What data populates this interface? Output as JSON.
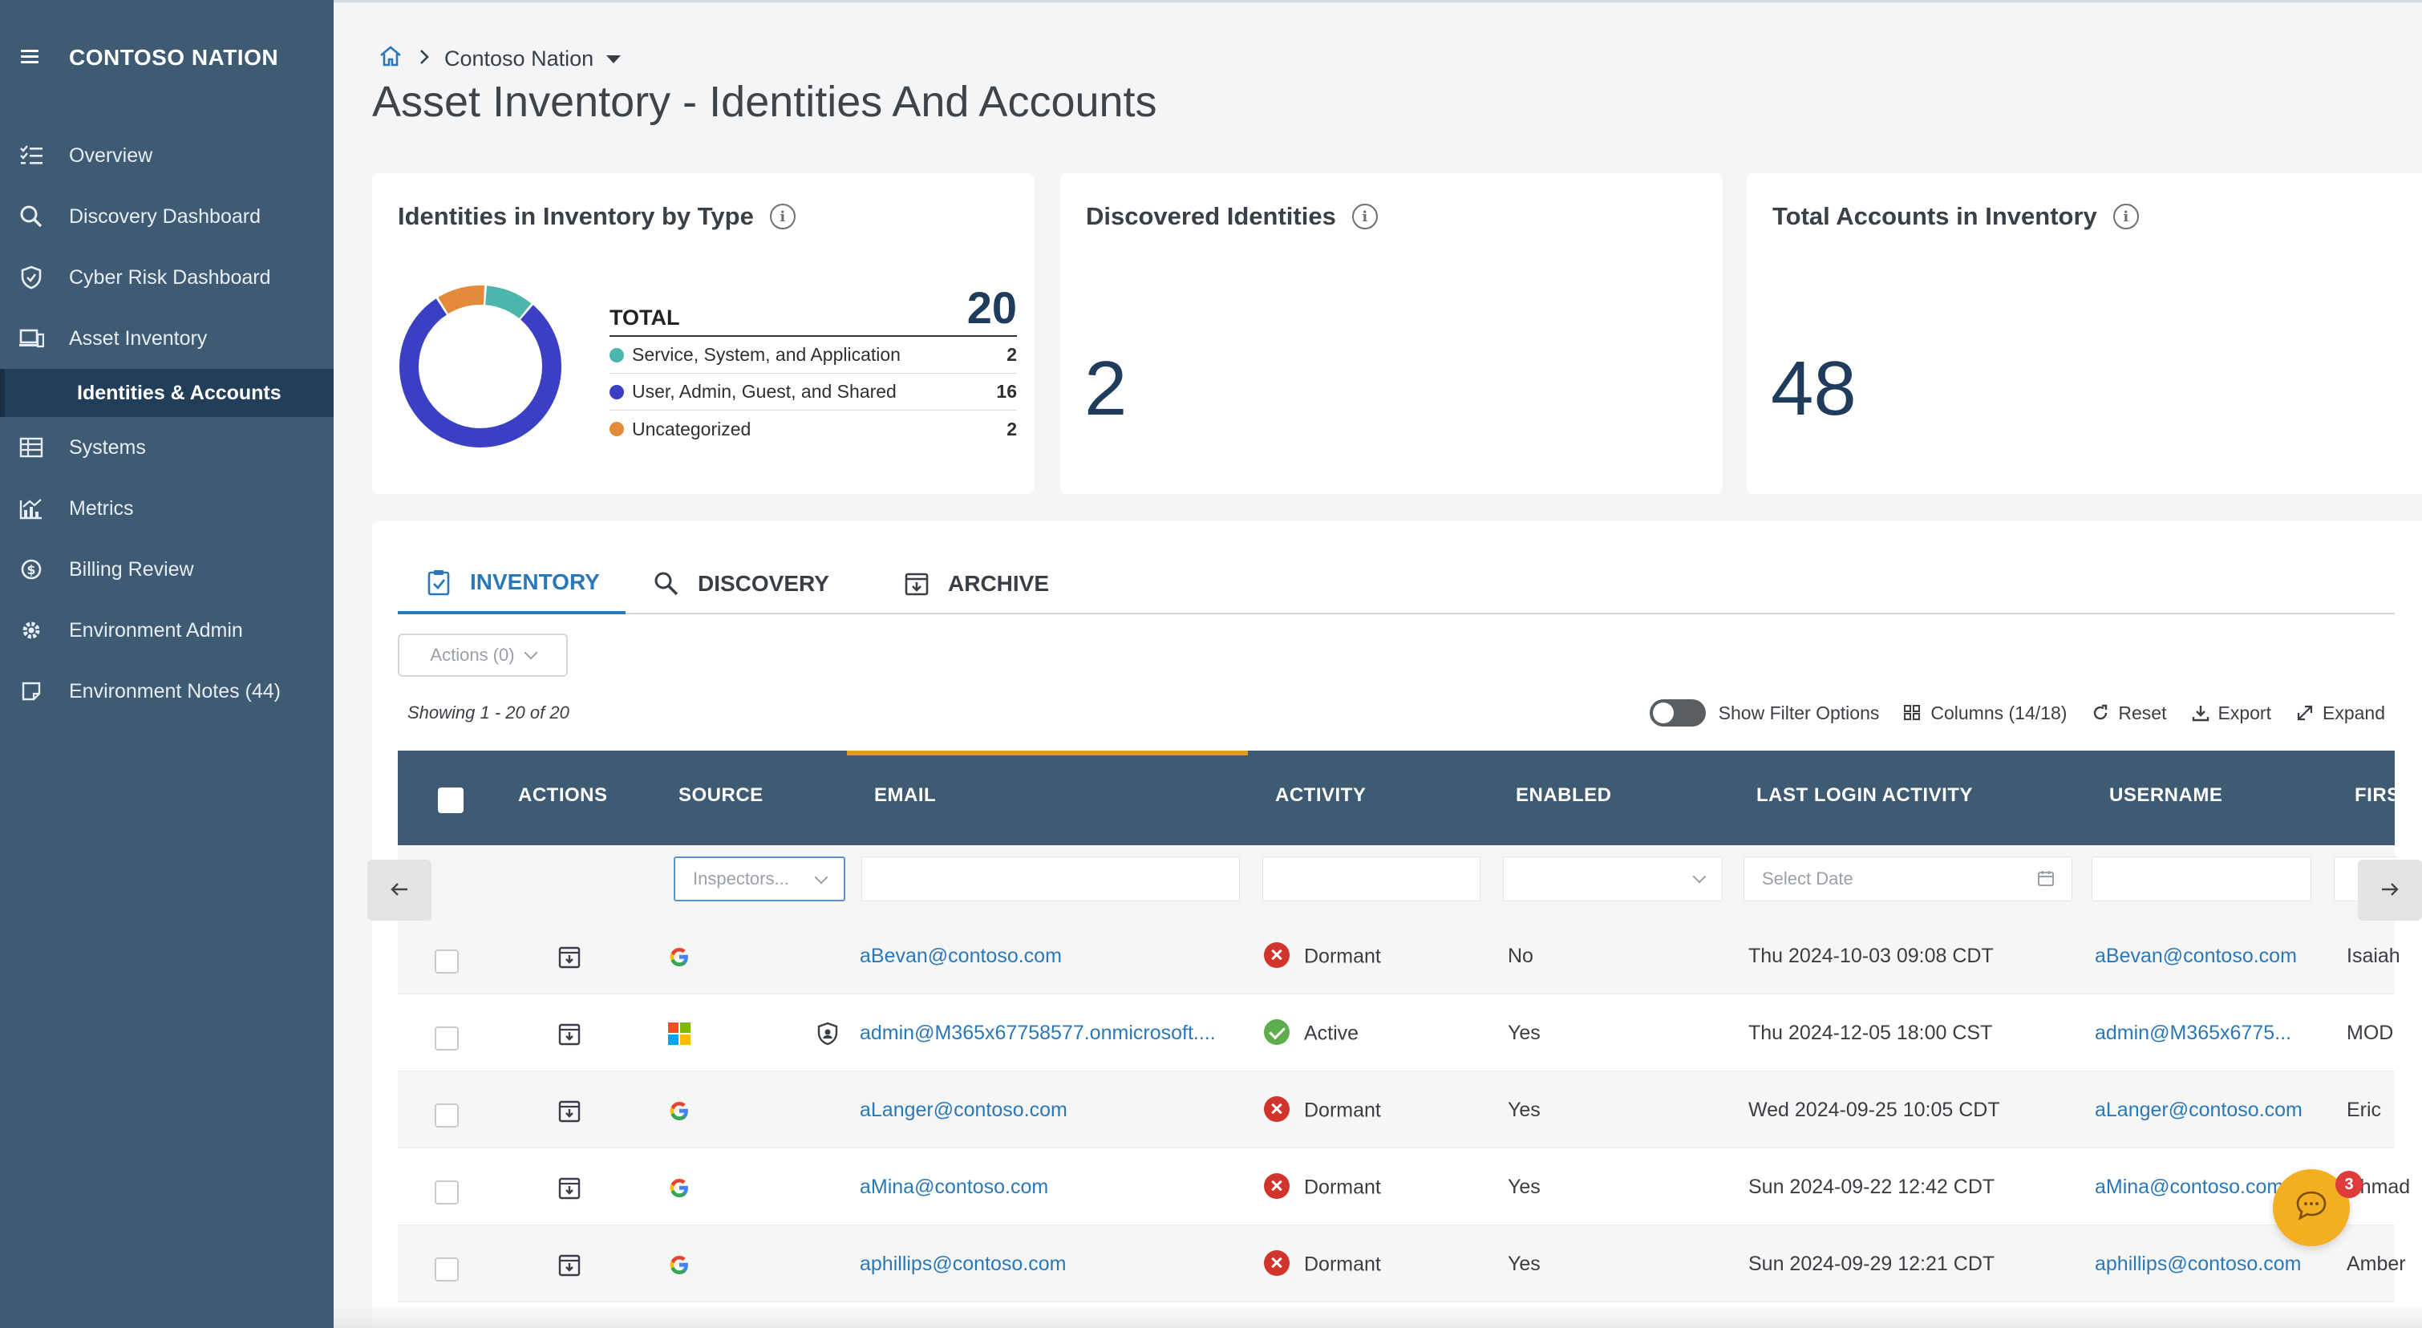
{
  "sidebar": {
    "brand": "CONTOSO NATION",
    "items": [
      {
        "label": "Overview",
        "icon": "list-check-icon"
      },
      {
        "label": "Discovery Dashboard",
        "icon": "search-icon"
      },
      {
        "label": "Cyber Risk Dashboard",
        "icon": "shield-check-icon"
      },
      {
        "label": "Asset Inventory",
        "icon": "devices-icon"
      },
      {
        "label": "Identities & Accounts",
        "icon": "",
        "selected": true
      },
      {
        "label": "Systems",
        "icon": "table-icon"
      },
      {
        "label": "Metrics",
        "icon": "chart-icon"
      },
      {
        "label": "Billing Review",
        "icon": "dollar-icon"
      },
      {
        "label": "Environment Admin",
        "icon": "gear-icon"
      },
      {
        "label": "Environment Notes (44)",
        "icon": "note-icon"
      }
    ]
  },
  "header": {
    "breadcrumb": "Contoso Nation",
    "title": "Asset Inventory - Identities And Accounts"
  },
  "cards": {
    "identities_by_type": {
      "title": "Identities in Inventory by Type",
      "total_label": "TOTAL",
      "total_value": "20",
      "segments": [
        {
          "label": "Service, System, and Application",
          "value": "2",
          "count": 2,
          "color": "#4db6ac"
        },
        {
          "label": "User, Admin, Guest, and Shared",
          "value": "16",
          "count": 16,
          "color": "#3b3fc4"
        },
        {
          "label": "Uncategorized",
          "value": "2",
          "count": 2,
          "color": "#e38b3a"
        }
      ]
    },
    "discovered": {
      "title": "Discovered Identities",
      "value": "2"
    },
    "total_accounts": {
      "title": "Total Accounts in Inventory",
      "value": "48"
    }
  },
  "tabs": [
    {
      "label": "INVENTORY",
      "active": true
    },
    {
      "label": "DISCOVERY",
      "active": false
    },
    {
      "label": "ARCHIVE",
      "active": false
    }
  ],
  "actions_label": "Actions (0)",
  "showing": "Showing 1 - 20 of 20",
  "toolbar": {
    "filter_label": "Show Filter Options",
    "columns_label": "Columns (14/18)",
    "reset_label": "Reset",
    "export_label": "Export",
    "expand_label": "Expand"
  },
  "table": {
    "columns": [
      "ACTIONS",
      "SOURCE",
      "EMAIL",
      "ACTIVITY",
      "ENABLED",
      "LAST LOGIN ACTIVITY",
      "USERNAME",
      "FIRS"
    ],
    "filters": {
      "source_value": "Inspectors...",
      "date_placeholder": "Select Date"
    },
    "rows": [
      {
        "source": "google",
        "email": "aBevan@contoso.com",
        "activity": "Dormant",
        "enabled": "No",
        "last_login": "Thu 2024-10-03 09:08 CDT",
        "username": "aBevan@contoso.com",
        "first": "Isaiah"
      },
      {
        "source": "microsoft",
        "email": "admin@M365x67758577.onmicrosoft....",
        "activity": "Active",
        "enabled": "Yes",
        "last_login": "Thu 2024-12-05 18:00 CST",
        "username": "admin@M365x6775...",
        "first": "MOD"
      },
      {
        "source": "google",
        "email": "aLanger@contoso.com",
        "activity": "Dormant",
        "enabled": "Yes",
        "last_login": "Wed 2024-09-25 10:05 CDT",
        "username": "aLanger@contoso.com",
        "first": "Eric"
      },
      {
        "source": "google",
        "email": "aMina@contoso.com",
        "activity": "Dormant",
        "enabled": "Yes",
        "last_login": "Sun 2024-09-22 12:42 CDT",
        "username": "aMina@contoso.com",
        "first": "Ahmad"
      },
      {
        "source": "google",
        "email": "aphillips@contoso.com",
        "activity": "Dormant",
        "enabled": "Yes",
        "last_login": "Sun 2024-09-29 12:21 CDT",
        "username": "aphillips@contoso.com",
        "first": "Amber"
      }
    ]
  },
  "chat": {
    "badge": "3"
  }
}
